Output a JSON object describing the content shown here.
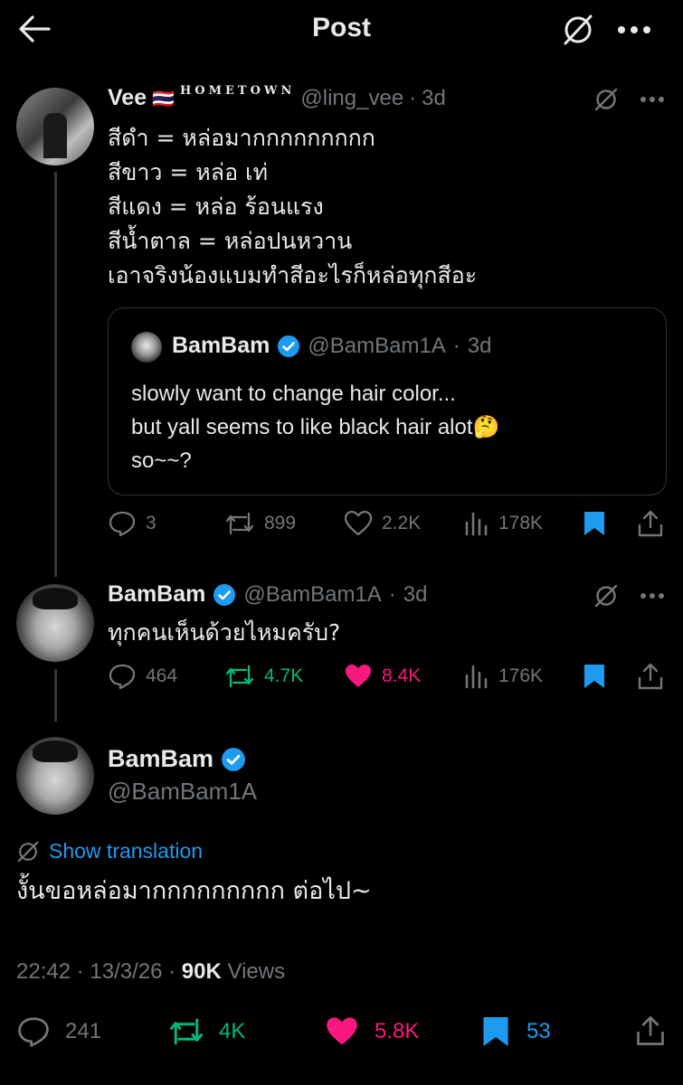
{
  "header": {
    "title": "Post"
  },
  "quoted_parent": {
    "name": "Vee",
    "flag": "🇹🇭",
    "badge_text": "HOMETOWN",
    "handle": "@ling_vee",
    "time": "3d",
    "lines": [
      "สีดำ = หล่อมากกกกกกกกก",
      "สีขาว =  หล่อ เท่",
      "สีแดง = หล่อ ร้อนแรง",
      "สีน้ำตาล = หล่อปนหวาน",
      "เอาจริงน้องแบมทำสีอะไรก็หล่อทุกสีอะ"
    ],
    "quote": {
      "name": "BamBam",
      "handle": "@BamBam1A",
      "time": "3d",
      "lines": [
        "slowly want to change hair color...",
        "but yall seems to like black hair alot🤔",
        "so~~?"
      ]
    },
    "actions": {
      "replies": "3",
      "reposts": "899",
      "likes": "2.2K",
      "views": "178K"
    }
  },
  "reply": {
    "name": "BamBam",
    "handle": "@BamBam1A",
    "time": "3d",
    "text": "ทุกคนเห็นด้วยไหมครับ?",
    "actions": {
      "replies": "464",
      "reposts": "4.7K",
      "likes": "8.4K",
      "views": "176K"
    }
  },
  "main": {
    "name": "BamBam",
    "handle": "@BamBam1A",
    "show_translation": "Show translation",
    "text": "งั้นขอหล่อมากกกกกกกกก ต่อไป~",
    "timestamp": "22:42 · 13/3/26 · ",
    "views_count": "90K",
    "views_label": " Views",
    "actions": {
      "replies": "241",
      "reposts": "4K",
      "likes": "5.8K",
      "bookmarks": "53"
    }
  },
  "colors": {
    "accent": "#1d9bf0",
    "like": "#f91880",
    "repost": "#00ba7c",
    "muted": "#71767b"
  }
}
